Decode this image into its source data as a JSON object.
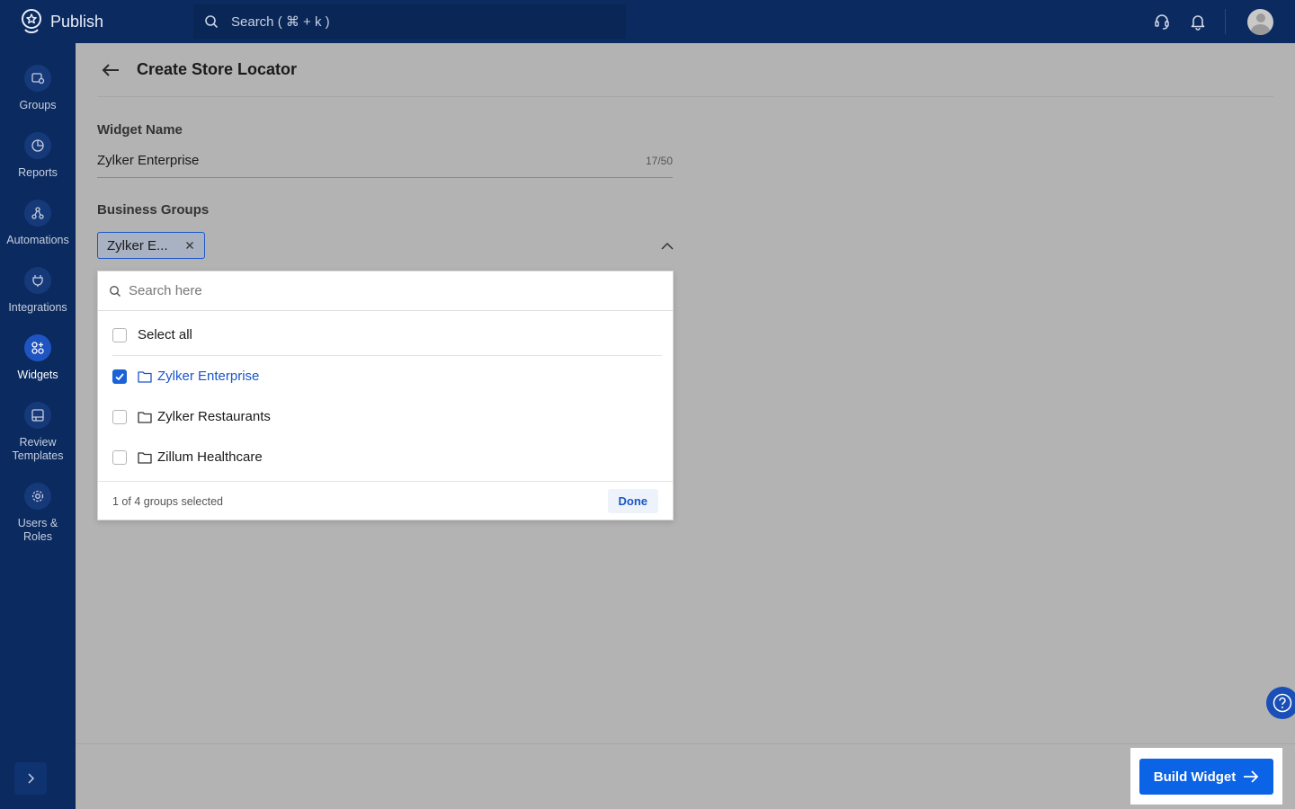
{
  "app": {
    "name": "Publish"
  },
  "search": {
    "placeholder": "Search ( ⌘ + k )"
  },
  "sidebar": {
    "items": [
      {
        "label": "Groups",
        "icon": "groups-icon"
      },
      {
        "label": "Reports",
        "icon": "reports-icon"
      },
      {
        "label": "Automations",
        "icon": "automations-icon"
      },
      {
        "label": "Integrations",
        "icon": "integrations-icon"
      },
      {
        "label": "Widgets",
        "icon": "widgets-icon",
        "active": true
      },
      {
        "label": "Review Templates",
        "icon": "review-templates-icon"
      },
      {
        "label": "Users & Roles",
        "icon": "users-roles-icon"
      }
    ]
  },
  "page": {
    "title": "Create Store Locator"
  },
  "widget_name": {
    "label": "Widget Name",
    "value": "Zylker Enterprise",
    "count": "17/50"
  },
  "business_groups": {
    "label": "Business Groups",
    "chip": "Zylker E...",
    "dropdown": {
      "search_placeholder": "Search here",
      "select_all": "Select all",
      "options": [
        {
          "label": "Zylker Enterprise",
          "checked": true
        },
        {
          "label": "Zylker Restaurants",
          "checked": false
        },
        {
          "label": "Zillum Healthcare",
          "checked": false
        }
      ],
      "footer_count": "1 of 4 groups selected",
      "done_label": "Done"
    }
  },
  "footer": {
    "build_label": "Build Widget"
  },
  "colors": {
    "nav_bg": "#0b2a5f",
    "accent": "#0b63e5",
    "overlay": "#b3b3b3"
  }
}
